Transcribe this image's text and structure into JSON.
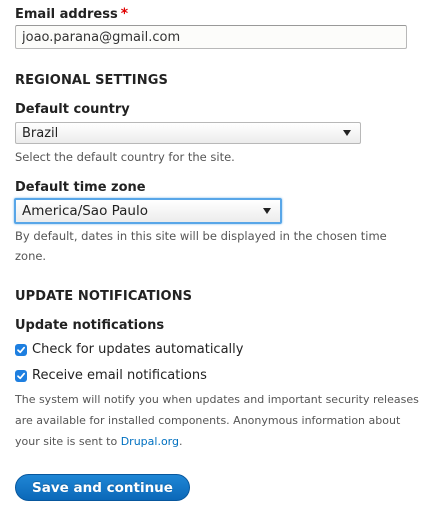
{
  "email": {
    "label": "Email address",
    "required_mark": "*",
    "value": "joao.parana@gmail.com"
  },
  "regional": {
    "heading": "REGIONAL SETTINGS",
    "country": {
      "label": "Default country",
      "value": "Brazil",
      "description": "Select the default country for the site."
    },
    "timezone": {
      "label": "Default time zone",
      "value": "America/Sao Paulo",
      "description_line1": "By default, dates in this site will be displayed in the chosen time",
      "description_line2": "zone."
    }
  },
  "updates": {
    "heading": "UPDATE NOTIFICATIONS",
    "group_label": "Update notifications",
    "options": [
      {
        "label": "Check for updates automatically",
        "checked": true
      },
      {
        "label": "Receive email notifications",
        "checked": true
      }
    ],
    "note_line1": "The system will notify you when updates and important security releases",
    "note_line2": "are available for installed components. Anonymous information about",
    "note_line3_prefix": "your site is sent to ",
    "note_link": "Drupal.org",
    "note_line3_suffix": "."
  },
  "submit": {
    "label": "Save and continue"
  },
  "colors": {
    "accent": "#0b68b8",
    "focus": "#58a6e8",
    "required": "#e00000",
    "link": "#0070c0"
  }
}
